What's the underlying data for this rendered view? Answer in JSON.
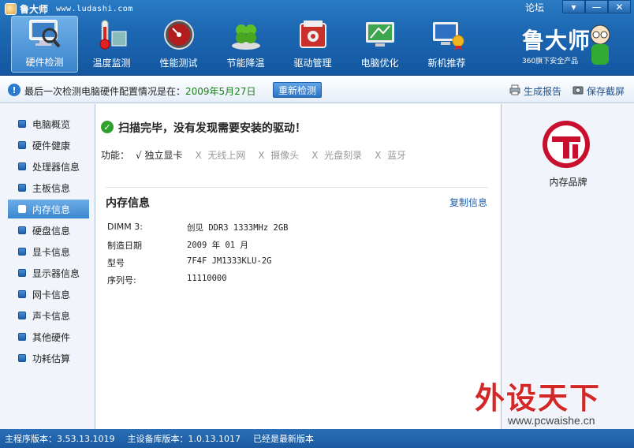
{
  "app": {
    "name": "鲁大师",
    "url": "www.ludashi.com",
    "forum": "论坛",
    "window_buttons": [
      "▾",
      "—",
      "✕"
    ]
  },
  "toolbar": [
    {
      "label": "硬件检测",
      "icon": "hardware-detect-icon",
      "active": true
    },
    {
      "label": "温度监测",
      "icon": "thermometer-icon",
      "active": false
    },
    {
      "label": "性能测试",
      "icon": "speedometer-icon",
      "active": false
    },
    {
      "label": "节能降温",
      "icon": "clover-icon",
      "active": false
    },
    {
      "label": "驱动管理",
      "icon": "driver-box-icon",
      "active": false
    },
    {
      "label": "电脑优化",
      "icon": "optimize-screen-icon",
      "active": false
    },
    {
      "label": "新机推荐",
      "icon": "new-pc-icon",
      "active": false
    }
  ],
  "brand": {
    "name": "鲁大师",
    "subtitle": "360旗下安全产品"
  },
  "infobar": {
    "text": "最后一次检测电脑硬件配置情况是在：",
    "date": "2009年5月27日",
    "recheck": "重新检测",
    "report": "生成报告",
    "save": "保存截屏"
  },
  "sidebar": {
    "items": [
      {
        "label": "电脑概览",
        "active": false
      },
      {
        "label": "硬件健康",
        "active": false
      },
      {
        "label": "处理器信息",
        "active": false
      },
      {
        "label": "主板信息",
        "active": false
      },
      {
        "label": "内存信息",
        "active": true
      },
      {
        "label": "硬盘信息",
        "active": false
      },
      {
        "label": "显卡信息",
        "active": false
      },
      {
        "label": "显示器信息",
        "active": false
      },
      {
        "label": "网卡信息",
        "active": false
      },
      {
        "label": "声卡信息",
        "active": false
      },
      {
        "label": "其他硬件",
        "active": false
      },
      {
        "label": "功耗估算",
        "active": false
      }
    ]
  },
  "main": {
    "scan_message": "扫描完毕，没有发现需要安装的驱动！",
    "features_label": "功能：",
    "features": [
      {
        "mark": "√",
        "label": "独立显卡",
        "enabled": true
      },
      {
        "mark": "X",
        "label": "无线上网",
        "enabled": false
      },
      {
        "mark": "X",
        "label": "摄像头",
        "enabled": false
      },
      {
        "mark": "X",
        "label": "光盘刻录",
        "enabled": false
      },
      {
        "mark": "X",
        "label": "蓝牙",
        "enabled": false
      }
    ],
    "section_title": "内存信息",
    "copy_label": "复制信息",
    "rows": [
      {
        "key": "DIMM 3:",
        "value": "创见 DDR3 1333MHz 2GB"
      },
      {
        "key": "制造日期",
        "value": "2009 年 01 月"
      },
      {
        "key": "型号",
        "value": "7F4F JM1333KLU-2G"
      },
      {
        "key": "序列号:",
        "value": "11110000"
      }
    ]
  },
  "rightpanel": {
    "label": "内存品牌",
    "logo_icon": "transcend-logo-icon"
  },
  "statusbar": {
    "main_version": "主程序版本：3.53.13.1019",
    "db_version": "主设备库版本：1.0.13.1017",
    "update_status": "已经是最新版本"
  },
  "watermark": {
    "main": "外设天下",
    "url": "www.pcwaishe.cn"
  }
}
